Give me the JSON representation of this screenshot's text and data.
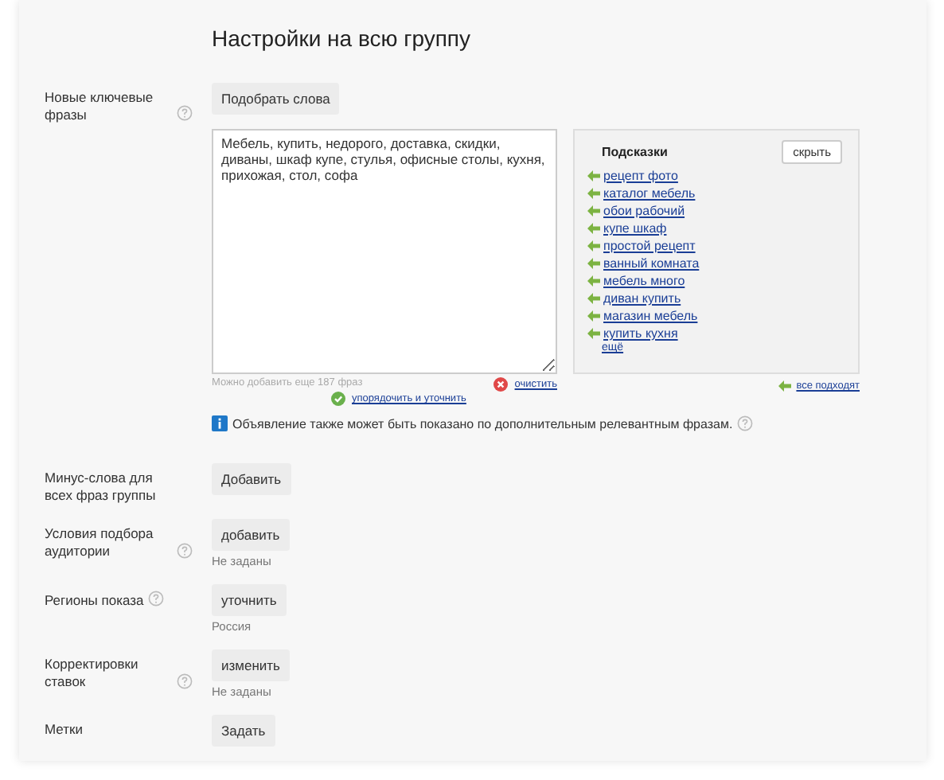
{
  "title": "Настройки на всю группу",
  "keywords": {
    "label": "Новые ключевые фразы",
    "help": true,
    "pick_button": "Подобрать слова",
    "value": "Мебель, купить, недорого, доставка, скидки, диваны, шкаф купе, стулья, офисные столы, кухня, прихожая, стол, софа",
    "remaining": "Можно добавить еще 187 фраз",
    "clear_link": "очистить",
    "sort_link": "упорядочить и уточнить",
    "info": "Объявление также может быть показано по дополнительным релевантным фразам.",
    "info_help": true
  },
  "suggestions": {
    "title": "Подсказки",
    "hide_button": "скрыть",
    "items": [
      "рецепт фото",
      "каталог мебель",
      "обои рабочий",
      "купе шкаф",
      "простой рецепт",
      "ванный комната",
      "мебель много",
      "диван купить",
      "магазин мебель",
      "купить кухня"
    ],
    "more": "ещё",
    "all_fit": "все подходят"
  },
  "rows": [
    {
      "label": "Минус-слова для всех фраз группы",
      "help": false,
      "button": "Добавить"
    },
    {
      "label": "Условия подбора аудитории",
      "help": true,
      "button": "добавить",
      "note": "Не заданы"
    },
    {
      "label": "Регионы показа",
      "help": true,
      "button": "уточнить",
      "note": "Россия"
    },
    {
      "label": "Корректировки ставок",
      "help": true,
      "button": "изменить",
      "note": "Не заданы"
    },
    {
      "label": "Метки",
      "help": false,
      "button": "Задать"
    }
  ]
}
